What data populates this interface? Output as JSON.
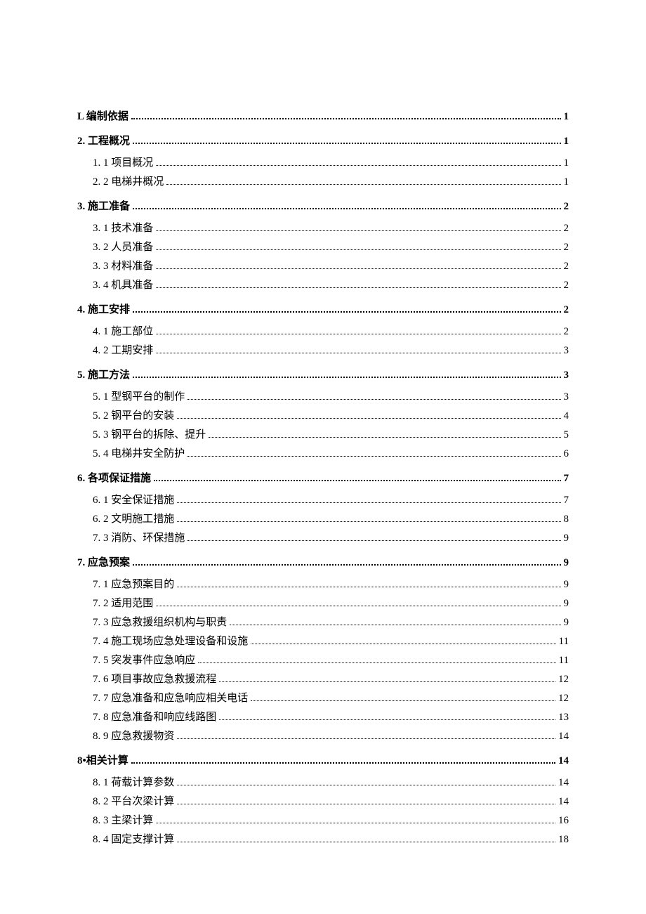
{
  "toc": {
    "sections": [
      {
        "label": "L 编制依据",
        "page": "1",
        "items": []
      },
      {
        "label": "2. 工程概况",
        "page": "1",
        "items": [
          {
            "label": "1.  1 项目概况",
            "page": "1"
          },
          {
            "label": "2.  2 电梯井概况",
            "page": "1"
          }
        ]
      },
      {
        "label": "3. 施工准备",
        "page": "2",
        "items": [
          {
            "label": "3.  1 技术准备",
            "page": "2"
          },
          {
            "label": "3. 2 人员准备",
            "page": "2"
          },
          {
            "label": "3. 3 材料准备",
            "page": "2"
          },
          {
            "label": "3.  4 机具准备",
            "page": "2"
          }
        ]
      },
      {
        "label": "4. 施工安排",
        "page": "2",
        "items": [
          {
            "label": "4.  1 施工部位",
            "page": "2"
          },
          {
            "label": "4.  2 工期安排",
            "page": "3"
          }
        ]
      },
      {
        "label": "5. 施工方法",
        "page": "3",
        "items": [
          {
            "label": "5. 1   型钢平台的制作",
            "page": "3"
          },
          {
            "label": "5.  2 钢平台的安装",
            "page": "4"
          },
          {
            "label": "5.  3 钢平台的拆除、提升",
            "page": "5"
          },
          {
            "label": "5.  4 电梯井安全防护",
            "page": "6"
          }
        ]
      },
      {
        "label": "6.   各项保证措施",
        "page": "7",
        "items": [
          {
            "label": "6. 1 安全保证措施",
            "page": "7"
          },
          {
            "label": "6.  2 文明施工措施",
            "page": "8"
          },
          {
            "label": "7.  3 消防、环保措施",
            "page": "9"
          }
        ]
      },
      {
        "label": "7. 应急预案",
        "page": "9",
        "items": [
          {
            "label": "7.  1 应急预案目的",
            "page": "9"
          },
          {
            "label": "7.  2 适用范围",
            "page": "9"
          },
          {
            "label": "7.  3 应急救援组织机构与职责",
            "page": "9"
          },
          {
            "label": "7.  4 施工现场应急处理设备和设施",
            "page": "11"
          },
          {
            "label": "7.  5 突发事件应急响应",
            "page": "11"
          },
          {
            "label": "7.  6 项目事故应急救援流程",
            "page": "12"
          },
          {
            "label": "7.  7 应急准备和应急响应相关电话",
            "page": "12"
          },
          {
            "label": "7.  8 应急准备和响应线路图",
            "page": "13"
          },
          {
            "label": "8.  9 应急救援物资",
            "page": "14"
          }
        ]
      },
      {
        "label": "8•相关计算",
        "page": "14",
        "items": [
          {
            "label": "8.  1 荷载计算参数",
            "page": "14"
          },
          {
            "label": "8.  2 平台次梁计算",
            "page": "14"
          },
          {
            "label": "8.  3 主梁计算",
            "page": "16"
          },
          {
            "label": "8.  4 固定支撑计算",
            "page": "18"
          }
        ]
      }
    ]
  }
}
